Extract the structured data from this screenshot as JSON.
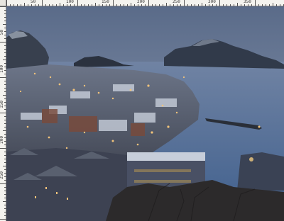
{
  "rulers": {
    "top_labels": [
      "50",
      "100",
      "150",
      "200",
      "250",
      "300",
      "350"
    ],
    "left_labels": [
      "50",
      "100",
      "150",
      "200",
      "250"
    ]
  },
  "canvas": {
    "subject": "city-photo"
  },
  "colors": {
    "sky_top": "#5e6f8c",
    "sky_bottom": "#8a98b0",
    "water": "#4a6a95",
    "mountain": "#2f3a4c",
    "city_light": "#f0c27a"
  }
}
